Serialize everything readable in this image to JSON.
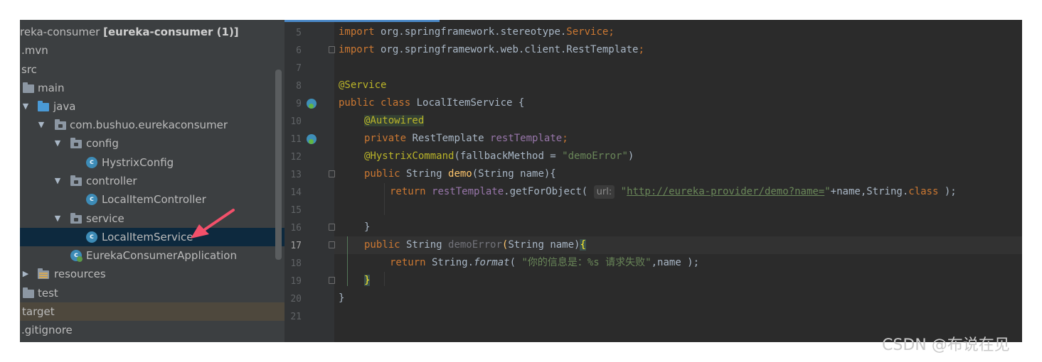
{
  "project_tree": {
    "items": [
      {
        "label": "reka-consumer",
        "suffix": "[eureka-consumer (1)]"
      },
      {
        "label": ".mvn"
      },
      {
        "label": "src"
      },
      {
        "label": "main"
      },
      {
        "label": "java"
      },
      {
        "label": "com.bushuo.eurekaconsumer"
      },
      {
        "label": "config"
      },
      {
        "label": "HystrixConfig"
      },
      {
        "label": "controller"
      },
      {
        "label": "LocalItemController"
      },
      {
        "label": "service"
      },
      {
        "label": "LocalItemService"
      },
      {
        "label": "EurekaConsumerApplication"
      },
      {
        "label": "resources"
      },
      {
        "label": "test"
      },
      {
        "label": "target"
      },
      {
        "label": ".gitignore"
      }
    ],
    "class_icon_glyph": "c"
  },
  "editor": {
    "line_numbers": [
      "5",
      "6",
      "7",
      "8",
      "9",
      "10",
      "11",
      "12",
      "13",
      "14",
      "15",
      "16",
      "17",
      "18",
      "19",
      "20",
      "21"
    ],
    "current_line": "17",
    "code": {
      "l5": {
        "kw": "import",
        "a": " org.springframework.stereotype.",
        "b": "Service",
        "c": ";"
      },
      "l6": {
        "kw": "import",
        "a": " org.springframework.web.client.RestTemplate",
        "c": ";"
      },
      "l8": {
        "ann": "@Service"
      },
      "l9": {
        "kw1": "public",
        "kw2": "class",
        "name": " LocalItemService {"
      },
      "l10": {
        "ann": "@Autowired"
      },
      "l11": {
        "kw": "private",
        "type": " RestTemplate ",
        "field": "restTemplate",
        "end": ";"
      },
      "l12": {
        "ann": "@HystrixCommand",
        "a": "(fallbackMethod = ",
        "str": "\"demoError\"",
        "end": ")"
      },
      "l13": {
        "kw": "public",
        "a": " String ",
        "m": "demo",
        "b": "(String name){"
      },
      "l14": {
        "kw": "return",
        "field": "restTemplate",
        "a": ".getForObject(",
        "hint": "url:",
        "q1": "\"",
        "url": "http://eureka-provider/demo?name=",
        "q2": "\"",
        "b": "+name,String.",
        "kw2": "class",
        "c": " );"
      },
      "l16": {
        "a": "}"
      },
      "l17": {
        "kw": "public",
        "a": " String ",
        "m": "demoError",
        "p1": "(",
        "b": "String name)",
        "br": "{"
      },
      "l18": {
        "kw": "return",
        "a": " String.",
        "m": "format",
        "b": "( ",
        "str": "\"你的信息是：%s 请求失败\"",
        "c": ",name );"
      },
      "l19": {
        "br": "}"
      },
      "l20": {
        "a": "}"
      }
    }
  },
  "colors": {
    "keyword": "#cc7832",
    "annotation": "#bbb529",
    "string": "#6a8759",
    "field": "#9876aa",
    "method": "#ffc66d",
    "tree_bg": "#3c3f41",
    "editor_bg": "#2b2b2b",
    "selection": "#0d293e",
    "pointer_arrow": "#f2506a"
  },
  "watermark": "CSDN @布说在见"
}
